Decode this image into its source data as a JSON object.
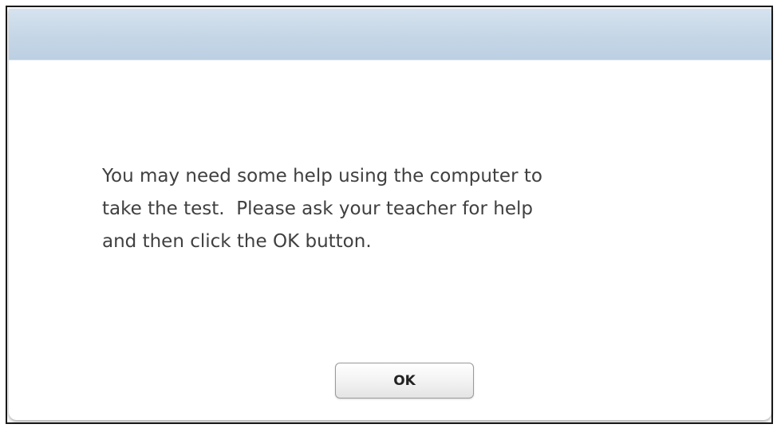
{
  "dialog": {
    "title": "",
    "message": "You may need some help using the computer to\ntake the test.  Please ask your teacher for help\nand then click the OK button.",
    "ok_button_label": "OK"
  }
}
